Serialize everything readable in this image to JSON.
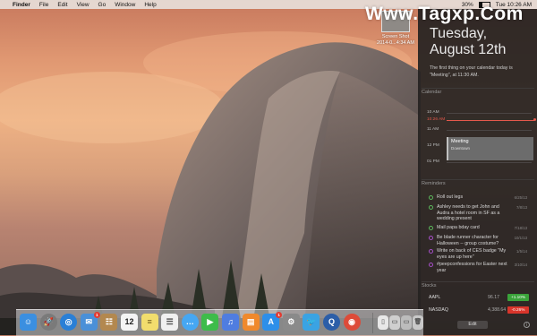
{
  "menubar": {
    "apple_glyph": "",
    "items": [
      "Finder",
      "File",
      "Edit",
      "View",
      "Go",
      "Window",
      "Help"
    ],
    "battery": "30%",
    "clock": "Tue 10:26 AM"
  },
  "watermark": "Www.Tagxp.Com",
  "desktop_file": {
    "name": "Screen Shot",
    "date": "2014-0...4:34 AM"
  },
  "notification_center": {
    "day": "Tuesday,",
    "month_day": "August 12th",
    "summary": "The first thing on your calendar today is \"Meeting\", at 11:30 AM.",
    "calendar": {
      "section": "Calendar",
      "rows": [
        "10 AM",
        "11 AM",
        "12 PM",
        "01 PM"
      ],
      "now": "10:26 AM",
      "event_title": "Meeting",
      "event_location": "Downtown"
    },
    "reminders": {
      "section": "Reminders",
      "items": [
        {
          "text": "Roll out legs",
          "date": "6/25/13",
          "color": "green"
        },
        {
          "text": "Ashley needs to get John and Audra a hotel room in SF as a wedding present",
          "date": "7/8/13",
          "color": "green"
        },
        {
          "text": "Mail papa bday card",
          "date": "7/18/13",
          "color": "green"
        },
        {
          "text": "Be blade runner character for Halloween -- group costume?",
          "date": "10/1/13",
          "color": "purple"
        },
        {
          "text": "Write on back of CES badge \"My eyes are up here\"",
          "date": "1/5/14",
          "color": "purple"
        },
        {
          "text": "#peepconfessions for Easter next year",
          "date": "3/10/14",
          "color": "purple"
        }
      ]
    },
    "stocks": {
      "section": "Stocks",
      "items": [
        {
          "symbol": "AAPL",
          "price": "96.17",
          "change": "+1.10%",
          "color": "#3aa33a"
        },
        {
          "symbol": "NASDAQ",
          "price": "4,388.64",
          "change": "-0.26%",
          "color": "#d8352b"
        }
      ]
    },
    "edit_label": "Edit",
    "info_glyph": "i"
  },
  "dock": {
    "icons": [
      {
        "name": "finder-icon",
        "color": "#3b8fe0",
        "glyph": "☺"
      },
      {
        "name": "launchpad-icon",
        "color": "#7a7a7a",
        "glyph": "🚀"
      },
      {
        "name": "safari-icon",
        "color": "#2a7fd6",
        "glyph": "◎"
      },
      {
        "name": "mail-icon",
        "color": "#4a90d8",
        "glyph": "✉",
        "badge": "1"
      },
      {
        "name": "contacts-icon",
        "color": "#b3884f",
        "glyph": "☷"
      },
      {
        "name": "calendar-icon",
        "color": "#f4f4f4",
        "glyph": "12",
        "text_color": "#222"
      },
      {
        "name": "notes-icon",
        "color": "#f2dd6d",
        "glyph": "≡",
        "text_color": "#6d5a1c"
      },
      {
        "name": "reminders-icon",
        "color": "#f0f0f0",
        "glyph": "☰",
        "text_color": "#555"
      },
      {
        "name": "messages-icon",
        "color": "#46a7f2",
        "glyph": "…"
      },
      {
        "name": "facetime-icon",
        "color": "#3dbc4a",
        "glyph": "▶"
      },
      {
        "name": "itunes-icon",
        "color": "#4f7de0",
        "glyph": "♫"
      },
      {
        "name": "ibooks-icon",
        "color": "#f0892c",
        "glyph": "▤"
      },
      {
        "name": "app-store-icon",
        "color": "#2d8fe9",
        "glyph": "A",
        "badge": "1"
      },
      {
        "name": "system-preferences-icon",
        "color": "#8a8a8a",
        "glyph": "⚙"
      },
      {
        "name": "twitter-icon",
        "color": "#3aa3e3",
        "glyph": "🐦"
      },
      {
        "name": "quicktime-icon",
        "color": "#2c5ea8",
        "glyph": "Q"
      },
      {
        "name": "chrome-icon",
        "color": "#dd4b39",
        "glyph": "◉"
      },
      {
        "name": "document-icon",
        "color": "#e8e8e8",
        "glyph": "▯",
        "text_color": "#888"
      },
      {
        "name": "screenshots-stack-icon",
        "color": "#cfcfcf",
        "glyph": "▭",
        "text_color": "#666"
      },
      {
        "name": "downloads-stack-icon",
        "color": "#bcbcbc",
        "glyph": "▭",
        "text_color": "#666"
      },
      {
        "name": "trash-icon",
        "color": "#c9c9c9",
        "glyph": "🗑",
        "text_color": "#555"
      }
    ]
  }
}
